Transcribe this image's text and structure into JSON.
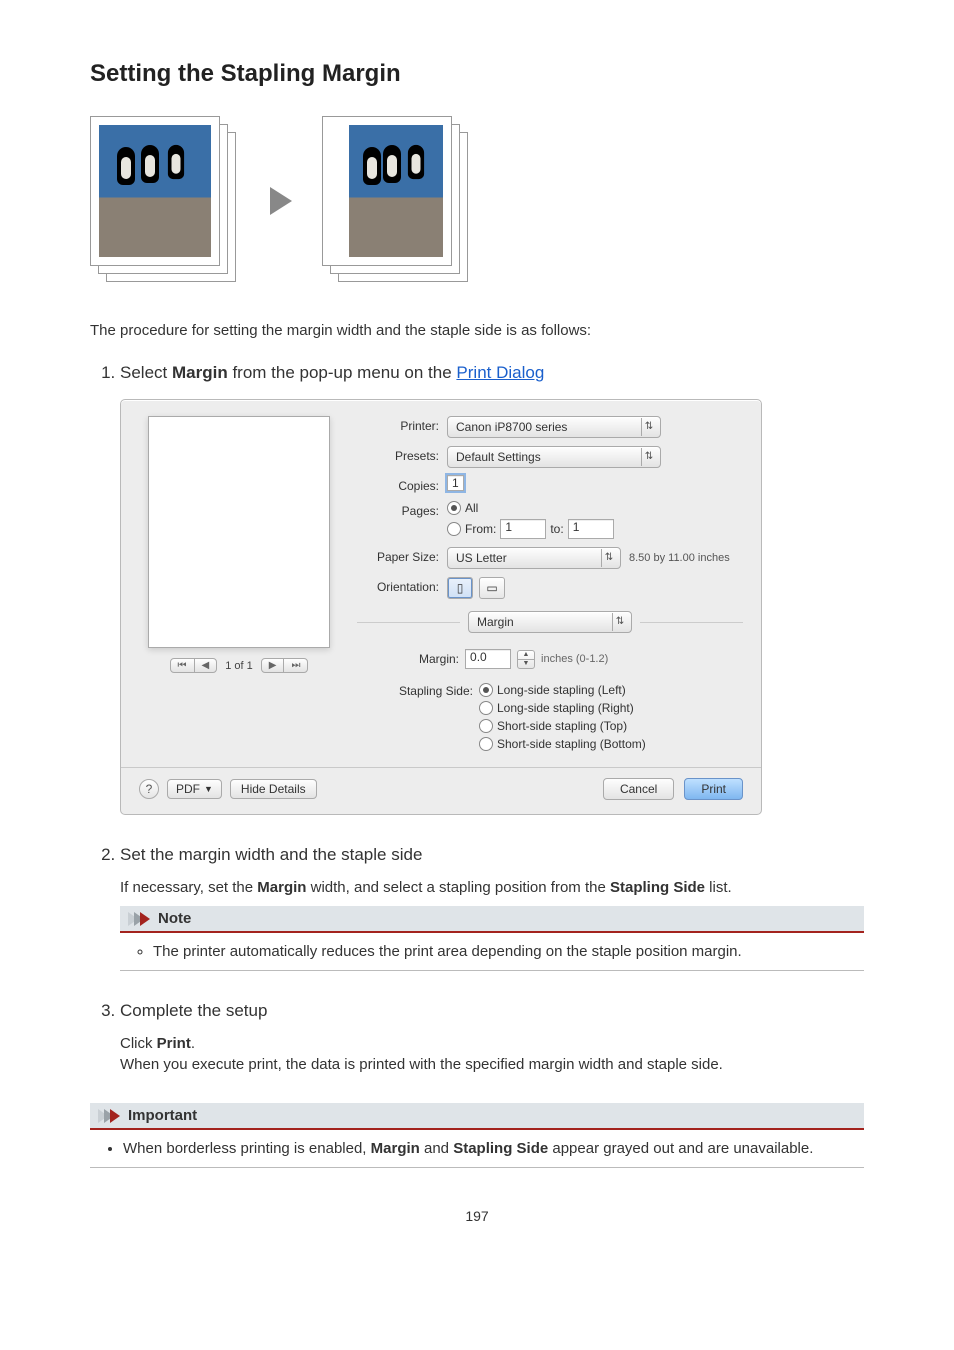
{
  "title": "Setting the Stapling Margin",
  "intro": "The procedure for setting the margin width and the staple side is as follows:",
  "steps": {
    "s1": {
      "prefix": "Select ",
      "bold": "Margin",
      "mid": " from the pop-up menu on the ",
      "link": "Print Dialog"
    },
    "s2": {
      "title": "Set the margin width and the staple side",
      "body_pre": "If necessary, set the ",
      "body_b1": "Margin",
      "body_mid": " width, and select a stapling position from the ",
      "body_b2": "Stapling Side",
      "body_post": " list."
    },
    "s3": {
      "title": "Complete the setup",
      "click_pre": "Click ",
      "click_b": "Print",
      "click_post": ".",
      "body2": "When you execute print, the data is printed with the specified margin width and staple side."
    }
  },
  "note": {
    "heading": "Note",
    "item": "The printer automatically reduces the print area depending on the staple position margin."
  },
  "important": {
    "heading": "Important",
    "item_pre": "When borderless printing is enabled, ",
    "item_b1": "Margin",
    "item_mid": " and ",
    "item_b2": "Stapling Side",
    "item_post": " appear grayed out and are unavailable."
  },
  "dialog": {
    "labels": {
      "printer": "Printer:",
      "presets": "Presets:",
      "copies": "Copies:",
      "pages": "Pages:",
      "all": "All",
      "from": "From:",
      "to": "to:",
      "paper_size": "Paper Size:",
      "orientation": "Orientation:",
      "margin": "Margin:",
      "stapling_side": "Stapling Side:"
    },
    "printer": "Canon iP8700 series",
    "presets": "Default Settings",
    "copies": "1",
    "from": "1",
    "to_val": "1",
    "paper_size": "US Letter",
    "paper_note": "8.50 by 11.00 inches",
    "section": "Margin",
    "margin_value": "0.0",
    "margin_note": "inches (0-1.2)",
    "stapling": {
      "o1": "Long-side stapling (Left)",
      "o2": "Long-side stapling (Right)",
      "o3": "Short-side stapling (Top)",
      "o4": "Short-side stapling (Bottom)"
    },
    "preview": {
      "page": "1 of 1"
    },
    "footer": {
      "pdf": "PDF",
      "hide": "Hide Details",
      "cancel": "Cancel",
      "print": "Print"
    }
  },
  "page_number": "197"
}
